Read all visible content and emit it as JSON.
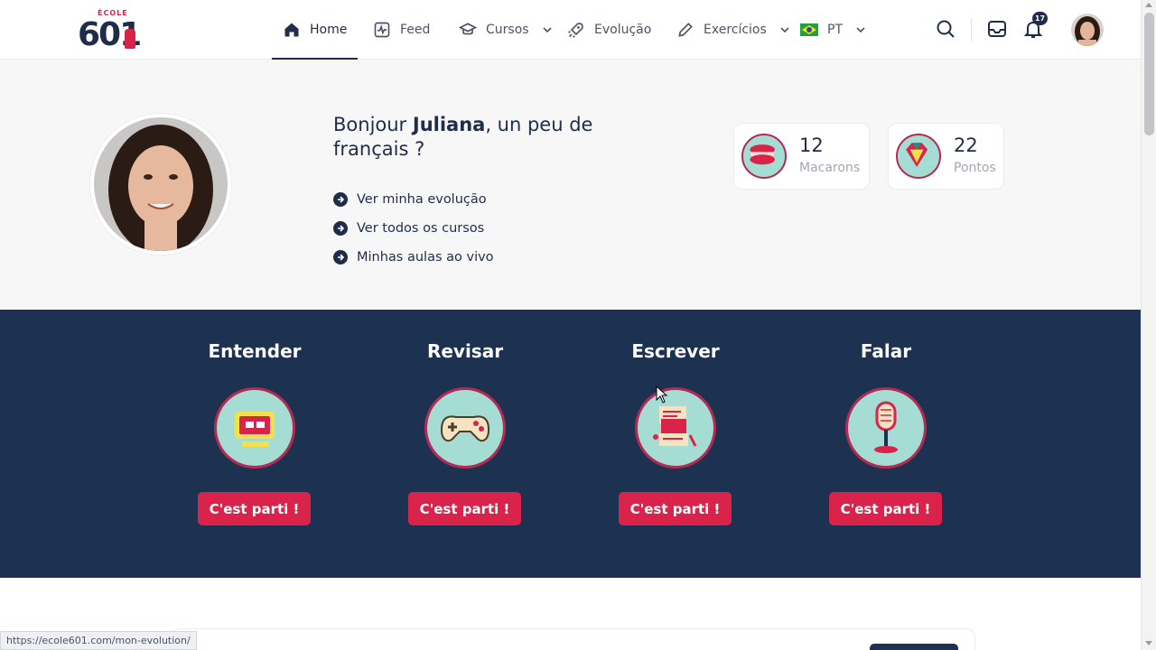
{
  "logo": {
    "top_text": "ÉCOLE",
    "number": "601"
  },
  "nav": {
    "items": [
      {
        "label": "Home",
        "icon": "home-icon"
      },
      {
        "label": "Feed",
        "icon": "activity-icon"
      },
      {
        "label": "Cursos",
        "icon": "graduation-cap-icon"
      },
      {
        "label": "Evolução",
        "icon": "rocket-icon"
      },
      {
        "label": "Exercícios",
        "icon": "pencil-icon"
      },
      {
        "label": "PT",
        "icon": "brazil-flag-icon"
      }
    ],
    "notifications_count": "17"
  },
  "hero": {
    "greeting_prefix": "Bonjour ",
    "user_name": "Juliana",
    "greeting_suffix": ", un peu de français ?",
    "links": [
      "Ver minha evolução",
      "Ver todos os cursos",
      "Minhas aulas ao vivo"
    ],
    "stats": [
      {
        "value": "12",
        "label": "Macarons",
        "icon": "macaron-icon"
      },
      {
        "value": "22",
        "label": "Pontos",
        "icon": "diamond-icon"
      }
    ]
  },
  "skills": [
    {
      "title": "Entender",
      "button": "C'est parti !",
      "icon": "computer-icon"
    },
    {
      "title": "Revisar",
      "button": "C'est parti !",
      "icon": "gamepad-icon"
    },
    {
      "title": "Escrever",
      "button": "C'est parti !",
      "icon": "letter-icon"
    },
    {
      "title": "Falar",
      "button": "C'est parti !",
      "icon": "microphone-icon"
    }
  ],
  "status_url": "https://ecole601.com/mon-evolution/",
  "colors": {
    "navy": "#1d3250",
    "accent_red": "#d9234a",
    "mint": "#a5dcd3",
    "ring": "#b42a55"
  }
}
